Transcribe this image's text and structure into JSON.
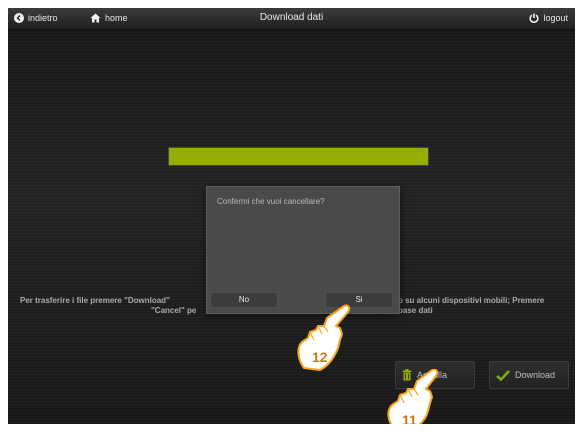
{
  "header": {
    "back_label": "indietro",
    "home_label": "home",
    "title": "Download dati",
    "logout_label": "logout"
  },
  "progress": {
    "value": 1.0,
    "color": "#b8d40a"
  },
  "instructions": {
    "left_line1": "Per trasferire i file premere \"Download\"",
    "left_line2": "\"Cancel\" pe",
    "right_line1": "o su alcuni dispositivi mobili; Premere",
    "right_line2": "base dati"
  },
  "actions": {
    "cancel_label": "Annulla",
    "download_label": "Download"
  },
  "dialog": {
    "message": "Confermi che vuoi cancellare?",
    "no_label": "No",
    "yes_label": "Si"
  },
  "callouts": {
    "yes_step": "12",
    "cancel_step": "11"
  },
  "colors": {
    "accent": "#b8d40a",
    "background": "#1f1f1f",
    "check": "#9fd21c",
    "trash": "#b8d40a",
    "callout": "#f5a623"
  }
}
